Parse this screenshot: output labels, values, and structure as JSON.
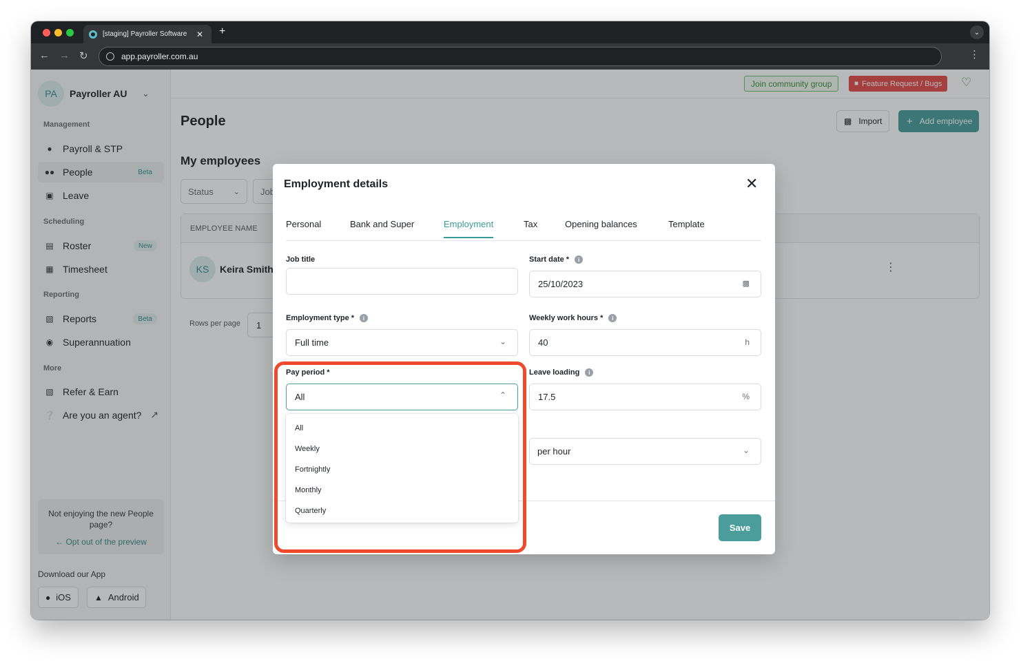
{
  "browser": {
    "tab_title": "[staging] Payroller Software",
    "tab_close": "✕",
    "new_tab": "+",
    "url": "app.payroller.com.au"
  },
  "sidebar": {
    "org_initials": "PA",
    "org_name": "Payroller AU",
    "sections": {
      "management": "Management",
      "scheduling": "Scheduling",
      "reporting": "Reporting",
      "more": "More"
    },
    "items": [
      {
        "label": "Payroll & STP",
        "icon": "payroll-icon",
        "badge": ""
      },
      {
        "label": "People",
        "icon": "people-icon",
        "badge": "Beta"
      },
      {
        "label": "Leave",
        "icon": "leave-icon",
        "badge": ""
      },
      {
        "label": "Roster",
        "icon": "roster-icon",
        "badge": "New"
      },
      {
        "label": "Timesheet",
        "icon": "timesheet-icon",
        "badge": ""
      },
      {
        "label": "Reports",
        "icon": "reports-icon",
        "badge": "Beta"
      },
      {
        "label": "Superannuation",
        "icon": "piggy-bank-icon",
        "badge": ""
      },
      {
        "label": "Refer & Earn",
        "icon": "refer-icon",
        "badge": ""
      },
      {
        "label": "Are you an agent?",
        "icon": "help-icon",
        "badge": ""
      }
    ],
    "optout_text": "Not enjoying the new People page?",
    "optout_link": "Opt out of the preview",
    "download_label": "Download our App",
    "ios_label": "iOS",
    "android_label": "Android"
  },
  "header": {
    "community_label": "Join community group",
    "feature_label": "Feature Request / Bugs"
  },
  "page": {
    "title": "People",
    "import_label": "Import",
    "add_employee_label": "Add employee",
    "section_title": "My employees",
    "filter_status": "Status",
    "filter_job": "Job",
    "table_header": "EMPLOYEE NAME",
    "employee_initials": "KS",
    "employee_name": "Keira Smith",
    "rows_per_page_label": "Rows per page",
    "rows_per_page_value": "1"
  },
  "modal": {
    "title": "Employment details",
    "tabs": [
      "Personal",
      "Bank and Super",
      "Employment",
      "Tax",
      "Opening balances",
      "Template"
    ],
    "active_tab": "Employment",
    "fields": {
      "job_title_label": "Job title",
      "job_title_value": "",
      "start_date_label": "Start date *",
      "start_date_value": "25/10/2023",
      "employment_type_label": "Employment type *",
      "employment_type_value": "Full time",
      "weekly_hours_label": "Weekly work hours *",
      "weekly_hours_value": "40",
      "weekly_hours_unit": "h",
      "pay_period_label": "Pay period *",
      "pay_period_value": "All",
      "leave_loading_label": "Leave loading",
      "leave_loading_value": "17.5",
      "leave_loading_unit": "%",
      "rate_unit_value": "per hour"
    },
    "pay_period_options": [
      "All",
      "Weekly",
      "Fortnightly",
      "Monthly",
      "Quarterly"
    ],
    "save_label": "Save"
  },
  "colors": {
    "accent": "#4a9d9b",
    "highlight": "#ef4a2c",
    "community": "#3c8f3c",
    "feature": "#e24b4b"
  }
}
